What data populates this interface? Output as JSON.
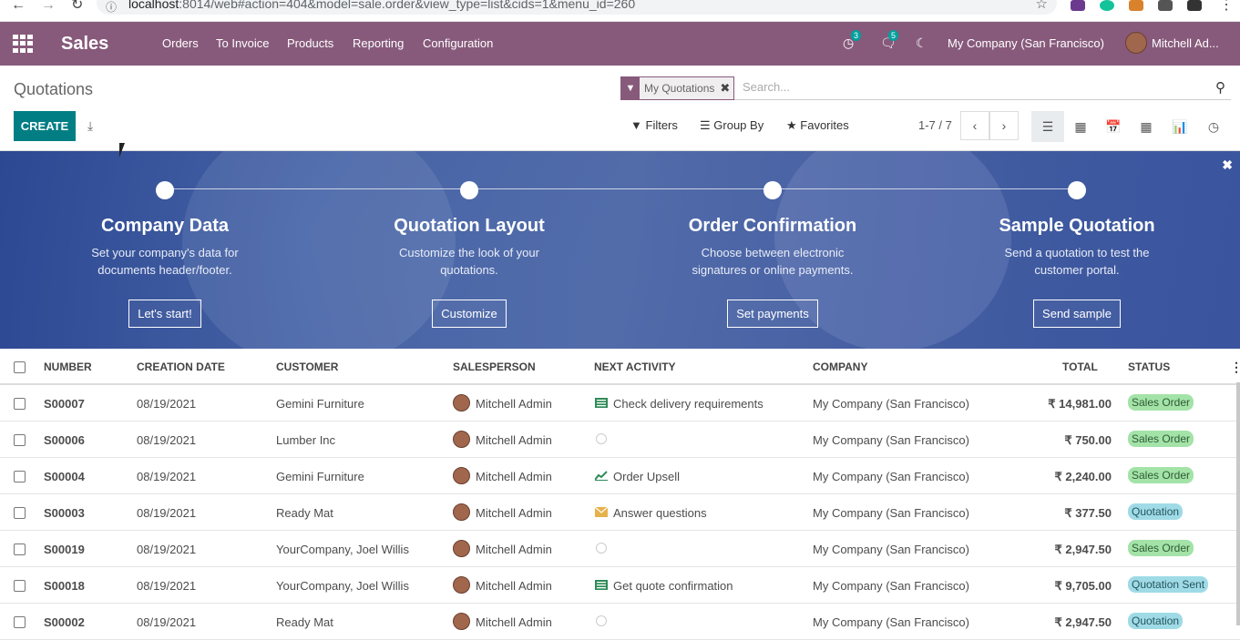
{
  "browser": {
    "url_host": "localhost",
    "url_rest": ":8014/web#action=404&model=sale.order&view_type=list&cids=1&menu_id=260"
  },
  "navbar": {
    "brand": "Sales",
    "menu": [
      "Orders",
      "To Invoice",
      "Products",
      "Reporting",
      "Configuration"
    ],
    "activity_count": "3",
    "messages_count": "5",
    "company": "My Company (San Francisco)",
    "user": "Mitchell Ad..."
  },
  "control_panel": {
    "title": "Quotations",
    "create_label": "CREATE",
    "facet_label": "My Quotations",
    "search_placeholder": "Search...",
    "filters_label": "Filters",
    "groupby_label": "Group By",
    "favorites_label": "Favorites",
    "pager": "1-7 / 7"
  },
  "banner": {
    "steps": [
      {
        "title": "Company Data",
        "desc": "Set your company's data for documents header/footer.",
        "button": "Let's start!"
      },
      {
        "title": "Quotation Layout",
        "desc": "Customize the look of your quotations.",
        "button": "Customize"
      },
      {
        "title": "Order Confirmation",
        "desc": "Choose between electronic signatures or online payments.",
        "button": "Set payments"
      },
      {
        "title": "Sample Quotation",
        "desc": "Send a quotation to test the customer portal.",
        "button": "Send sample"
      }
    ]
  },
  "table": {
    "headers": {
      "number": "NUMBER",
      "creation_date": "CREATION DATE",
      "customer": "CUSTOMER",
      "salesperson": "SALESPERSON",
      "next_activity": "NEXT ACTIVITY",
      "company": "COMPANY",
      "total": "TOTAL",
      "status": "STATUS"
    },
    "rows": [
      {
        "number": "S00007",
        "date": "08/19/2021",
        "customer": "Gemini Furniture",
        "salesperson": "Mitchell Admin",
        "activity": "Check delivery requirements",
        "activity_icon": "list-icon",
        "company": "My Company (San Francisco)",
        "total": "₹ 14,981.00",
        "status": "Sales Order",
        "status_kind": "so"
      },
      {
        "number": "S00006",
        "date": "08/19/2021",
        "customer": "Lumber Inc",
        "salesperson": "Mitchell Admin",
        "activity": "",
        "activity_icon": "clock-icon",
        "company": "My Company (San Francisco)",
        "total": "₹ 750.00",
        "status": "Sales Order",
        "status_kind": "so"
      },
      {
        "number": "S00004",
        "date": "08/19/2021",
        "customer": "Gemini Furniture",
        "salesperson": "Mitchell Admin",
        "activity": "Order Upsell",
        "activity_icon": "chart-icon",
        "company": "My Company (San Francisco)",
        "total": "₹ 2,240.00",
        "status": "Sales Order",
        "status_kind": "so"
      },
      {
        "number": "S00003",
        "date": "08/19/2021",
        "customer": "Ready Mat",
        "salesperson": "Mitchell Admin",
        "activity": "Answer questions",
        "activity_icon": "envelope-icon",
        "company": "My Company (San Francisco)",
        "total": "₹ 377.50",
        "status": "Quotation",
        "status_kind": "qt"
      },
      {
        "number": "S00019",
        "date": "08/19/2021",
        "customer": "YourCompany, Joel Willis",
        "salesperson": "Mitchell Admin",
        "activity": "",
        "activity_icon": "clock-icon",
        "company": "My Company (San Francisco)",
        "total": "₹ 2,947.50",
        "status": "Sales Order",
        "status_kind": "so"
      },
      {
        "number": "S00018",
        "date": "08/19/2021",
        "customer": "YourCompany, Joel Willis",
        "salesperson": "Mitchell Admin",
        "activity": "Get quote confirmation",
        "activity_icon": "list-icon",
        "company": "My Company (San Francisco)",
        "total": "₹ 9,705.00",
        "status": "Quotation Sent",
        "status_kind": "qs"
      },
      {
        "number": "S00002",
        "date": "08/19/2021",
        "customer": "Ready Mat",
        "salesperson": "Mitchell Admin",
        "activity": "",
        "activity_icon": "clock-icon",
        "company": "My Company (San Francisco)",
        "total": "₹ 2,947.50",
        "status": "Quotation",
        "status_kind": "qt"
      }
    ]
  },
  "colors": {
    "navbar": "#875a7b",
    "primary_button": "#017e84",
    "banner": "#3f5fa8",
    "status_sales_order": "#a3e3a8",
    "status_quotation": "#9fdbe6"
  }
}
